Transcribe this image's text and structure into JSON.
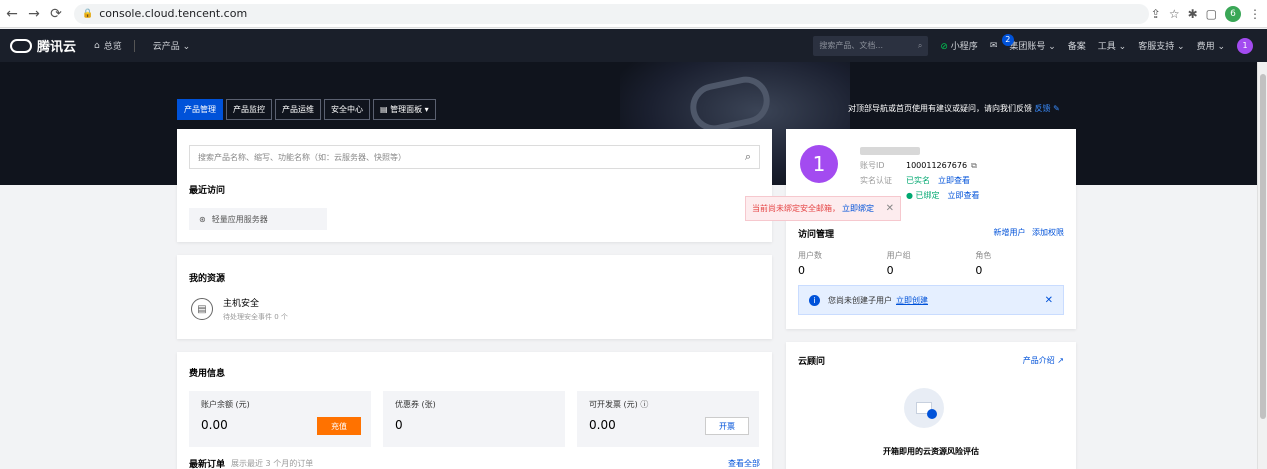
{
  "browser": {
    "url": "console.cloud.tencent.com",
    "profile_initial": "6"
  },
  "topnav": {
    "brand": "腾讯云",
    "overview": "总览",
    "products": "云产品 ⌄",
    "search_placeholder": "搜索产品、文档...",
    "mini_program": "小程序",
    "message_badge": "2",
    "group_account": "集团账号 ⌄",
    "filing": "备案",
    "tools": "工具 ⌄",
    "support": "客服支持 ⌄",
    "billing": "费用 ⌄",
    "user_initial": "1"
  },
  "hero": {
    "tabs": [
      "产品管理",
      "产品监控",
      "产品运维",
      "安全中心"
    ],
    "panel_tab": "管理面板",
    "feedback_text": "对顶部导航或首页使用有建议或疑问，请向我们反馈",
    "feedback_link": "反馈"
  },
  "product_card": {
    "search_placeholder": "搜索产品名称、缩写、功能名称（如：云服务器、快照等）",
    "recent_title": "最近访问",
    "recent_item": "轻量应用服务器"
  },
  "resources_card": {
    "title": "我的资源",
    "item_name": "主机安全",
    "item_sub": "待处理安全事件 0 个"
  },
  "fee_card": {
    "title": "费用信息",
    "balance_label": "账户余额 (元)",
    "balance_value": "0.00",
    "recharge": "充值",
    "coupon_label": "优惠券 (张)",
    "coupon_value": "0",
    "invoice_label": "可开发票 (元) ⓘ",
    "invoice_value": "0.00",
    "invoice_button": "开票",
    "orders_title": "最新订单",
    "orders_sub": "展示最近 3 个月的订单",
    "view_all": "查看全部"
  },
  "account_card": {
    "avatar_initial": "1",
    "id_label": "账号ID",
    "id_value": "100011267676",
    "realname_label": "实名认证",
    "realname_status": "已实名",
    "realname_link": "立即查看",
    "wechat_status": "已绑定",
    "wechat_link": "立即查看",
    "access_title": "访问管理",
    "new_user": "新增用户",
    "add_perm": "添加权限",
    "stats": [
      {
        "label": "用户数",
        "value": "0"
      },
      {
        "label": "用户组",
        "value": "0"
      },
      {
        "label": "角色",
        "value": "0"
      }
    ],
    "info_text": "您尚未创建子用户",
    "info_link": "立即创建"
  },
  "toast": {
    "text": "当前尚未绑定安全邮箱，",
    "link": "立即绑定"
  },
  "advisor_card": {
    "title": "云顾问",
    "intro_link": "产品介绍",
    "headline": "开箱即用的云资源风险评估"
  }
}
